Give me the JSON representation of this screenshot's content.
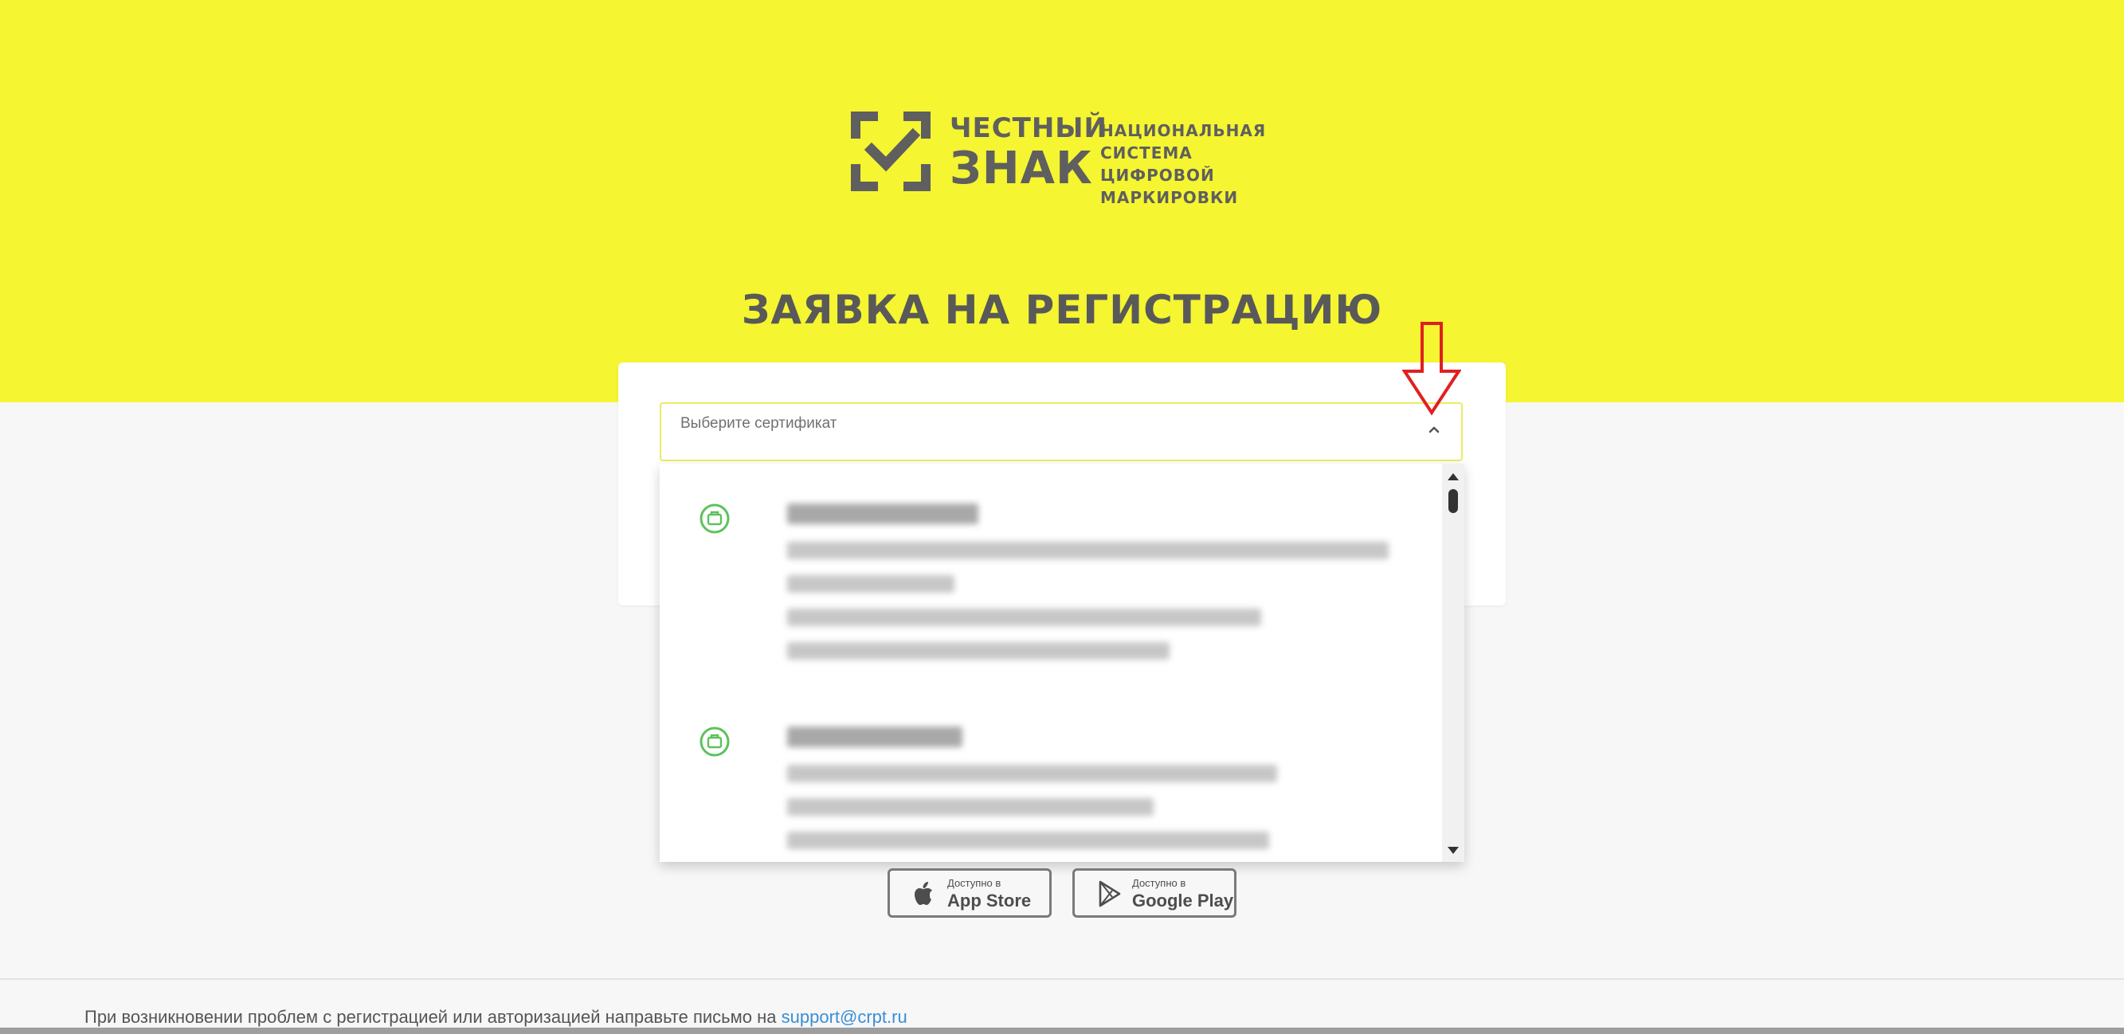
{
  "brand": {
    "word_line1": "ЧЕСТНЫЙ",
    "word_line2": "ЗНАК",
    "tagline": [
      "НАЦИОНАЛЬНАЯ",
      "СИСТЕМА ЦИФРОВОЙ",
      "МАРКИРОВКИ"
    ]
  },
  "page_title": "ЗАЯВКА НА РЕГИСТРАЦИЮ",
  "certificate_select": {
    "placeholder": "Выберите сертификат",
    "icon": "chevron-up-icon",
    "options": [
      {
        "icon": "briefcase-icon",
        "content": "blurred"
      },
      {
        "icon": "briefcase-icon",
        "content": "blurred"
      }
    ]
  },
  "stores": {
    "app_store": {
      "sub": "Доступно в",
      "name": "App Store",
      "icon": "apple-icon"
    },
    "google_play": {
      "sub": "Доступно в",
      "name": "Google Play",
      "icon": "google-play-icon"
    }
  },
  "footer": {
    "text": "При возникновении проблем с регистрацией или авторизацией направьте письмо на ",
    "email": "support@crpt.ru"
  },
  "colors": {
    "hero_yellow": "#f5f531",
    "text_gray": "#595959",
    "icon_green": "#5cc25c",
    "link_blue": "#3a8ed6",
    "annotation_red": "#e02020"
  }
}
